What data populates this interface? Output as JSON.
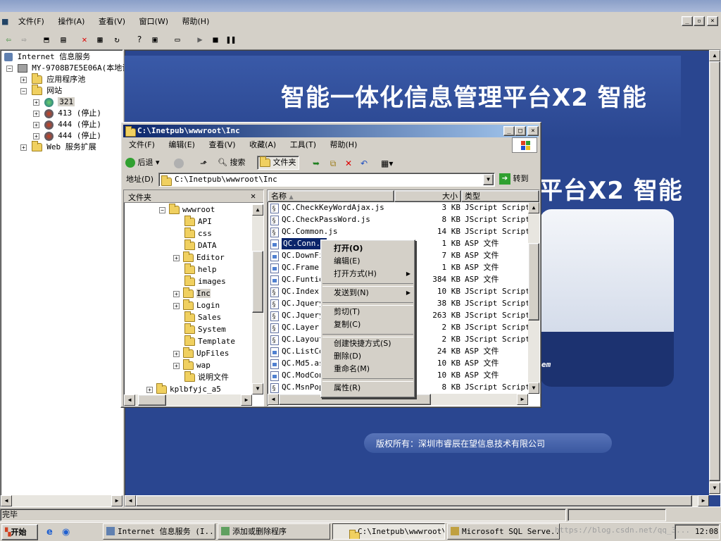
{
  "app": {
    "menu": [
      "文件(F)",
      "操作(A)",
      "查看(V)",
      "窗口(W)",
      "帮助(H)"
    ]
  },
  "tree": {
    "root": "Internet 信息服务",
    "server": "MY-9708B7E5E06A(本地计",
    "items": [
      "应用程序池",
      "网站",
      "321",
      "413 (停止)",
      "444 (停止)",
      "444 (停止)",
      "Web 服务扩展"
    ]
  },
  "banner": {
    "title": "智能一体化信息管理平台X2  智能",
    "title2": "平台X2  智能",
    "badge": "em",
    "copyright": "版权所有：深圳市睿辰在望信息技术有限公司"
  },
  "explorer": {
    "title": "C:\\Inetpub\\wwwroot\\Inc",
    "menu": [
      "文件(F)",
      "编辑(E)",
      "查看(V)",
      "收藏(A)",
      "工具(T)",
      "帮助(H)"
    ],
    "toolbar": {
      "back": "后退",
      "search": "搜索",
      "folders": "文件夹"
    },
    "address_label": "地址(D)",
    "address_value": "C:\\Inetpub\\wwwroot\\Inc",
    "go_label": "转到",
    "folders_header": "文件夹",
    "folders": [
      "wwwroot",
      "API",
      "css",
      "DATA",
      "Editor",
      "help",
      "images",
      "Inc",
      "Login",
      "Sales",
      "System",
      "Template",
      "UpFiles",
      "wap",
      "说明文件",
      "kplbfyjc_a5"
    ],
    "columns": [
      "名称",
      "大小",
      "类型"
    ],
    "files": [
      {
        "name": "QC.CheckKeyWordAjax.js",
        "size": "3 KB",
        "type": "JScript Script",
        "kind": "js"
      },
      {
        "name": "QC.CheckPassWord.js",
        "size": "8 KB",
        "type": "JScript Script",
        "kind": "js"
      },
      {
        "name": "QC.Common.js",
        "size": "14 KB",
        "type": "JScript Script",
        "kind": "js"
      },
      {
        "name": "QC.Conn.a",
        "size": "1 KB",
        "type": "ASP 文件",
        "kind": "asp"
      },
      {
        "name": "QC.DownFi",
        "size": "7 KB",
        "type": "ASP 文件",
        "kind": "asp"
      },
      {
        "name": "QC.Frame.",
        "size": "1 KB",
        "type": "ASP 文件",
        "kind": "asp"
      },
      {
        "name": "QC.Funtio",
        "size": "384 KB",
        "type": "ASP 文件",
        "kind": "asp"
      },
      {
        "name": "QC.Index.",
        "size": "10 KB",
        "type": "JScript Script",
        "kind": "js"
      },
      {
        "name": "QC.Jquery",
        "size": "38 KB",
        "type": "JScript Script",
        "kind": "js"
      },
      {
        "name": "QC.Jquery",
        "size": "263 KB",
        "type": "JScript Script",
        "kind": "js"
      },
      {
        "name": "QC.Layer.",
        "size": "2 KB",
        "type": "JScript Script",
        "kind": "js"
      },
      {
        "name": "QC.Layout",
        "size": "2 KB",
        "type": "JScript Script",
        "kind": "js"
      },
      {
        "name": "QC.ListCo",
        "size": "24 KB",
        "type": "ASP 文件",
        "kind": "asp"
      },
      {
        "name": "QC.Md5.as",
        "size": "10 KB",
        "type": "ASP 文件",
        "kind": "asp"
      },
      {
        "name": "QC.ModCon",
        "size": "10 KB",
        "type": "ASP 文件",
        "kind": "asp"
      },
      {
        "name": "QC.MsnPop",
        "size": "8 KB",
        "type": "JScript Script",
        "kind": "js"
      }
    ]
  },
  "context_menu": [
    "打开(O)",
    "编辑(E)",
    "打开方式(H)",
    "发送到(N)",
    "剪切(T)",
    "复制(C)",
    "创建快捷方式(S)",
    "删除(D)",
    "重命名(M)",
    "属性(R)"
  ],
  "status": {
    "text": "完毕"
  },
  "taskbar": {
    "start": "开始",
    "buttons": [
      "Internet 信息服务 (I...",
      "添加或删除程序",
      "C:\\Inetpub\\wwwroot\\Inc",
      "Microsoft SQL Serve..."
    ],
    "watermark": "https://blog.csdn.net/qq_3...",
    "clock": "12:08"
  },
  "colors": {
    "banner": "#2a4690",
    "title_active": "#0a246a",
    "selection": "#0a246a"
  }
}
